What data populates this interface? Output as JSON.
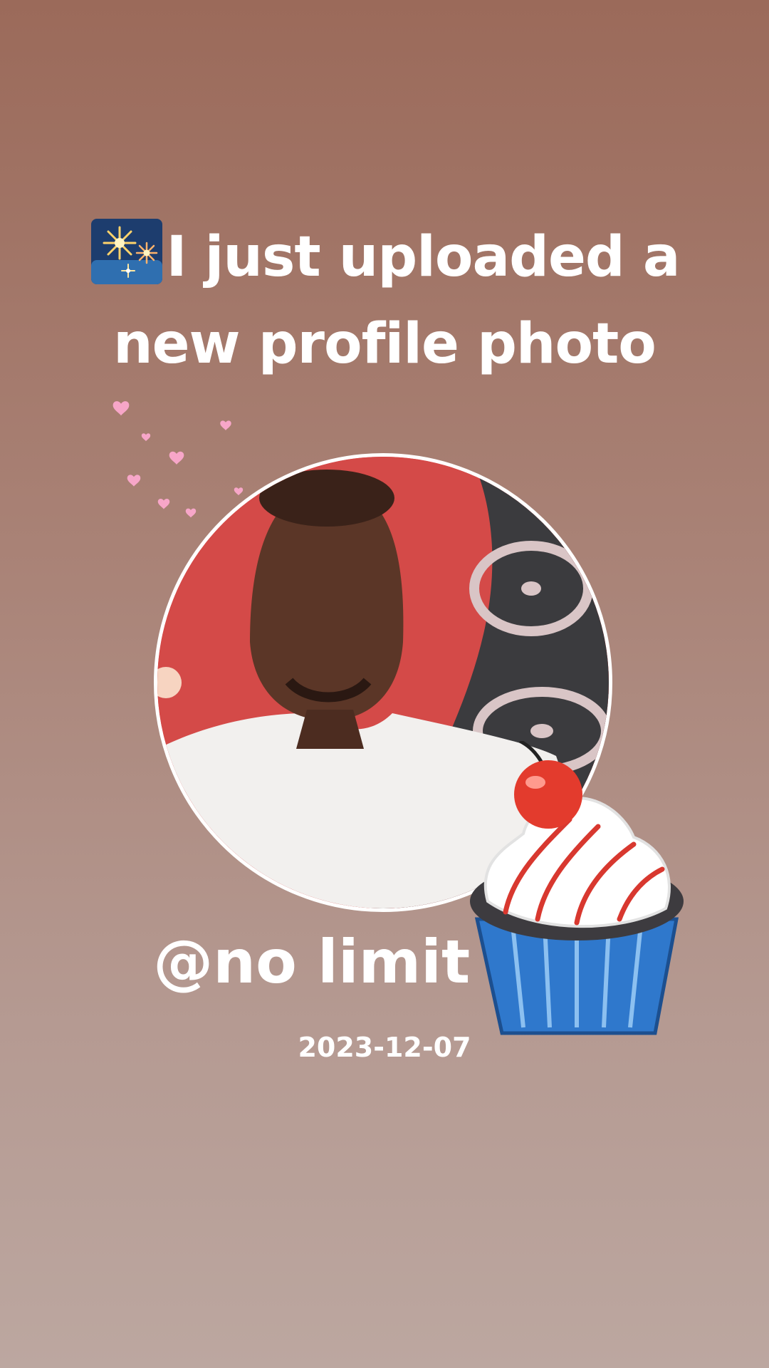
{
  "story": {
    "headline_line1": "I just uploaded a",
    "headline_line2": "new profile photo",
    "username": "@no limit 167",
    "date": "2023-12-07",
    "icons": {
      "headline": "fireworks-icon",
      "decoration": "hearts-icon",
      "sticker": "cupcake-icon"
    }
  },
  "colors": {
    "text": "#ffffff",
    "background_top": "#9b6a5a",
    "background_bottom": "#bca7a0",
    "heart": "#f7a6c8",
    "ring": "#ffffff"
  }
}
